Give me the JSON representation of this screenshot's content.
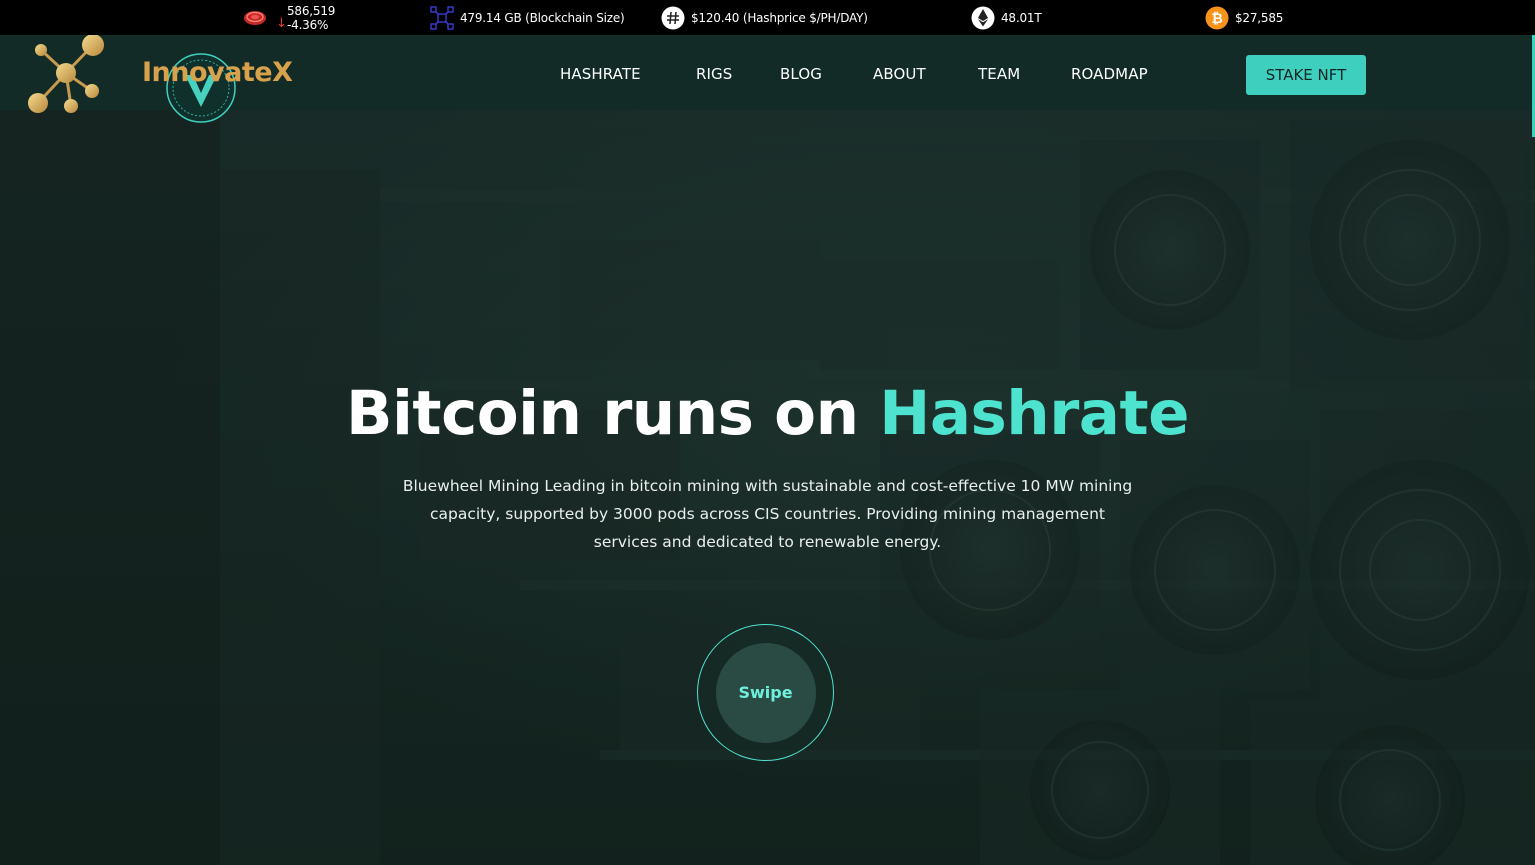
{
  "ticker": {
    "supply": {
      "value": "586,519",
      "change": "-4.36%",
      "icon": "red-coin-icon",
      "trend_icon": "arrow-down-icon"
    },
    "blockchain": {
      "text": "479.14 GB (Blockchain Size)",
      "icon": "blockchain-network-icon"
    },
    "hashprice": {
      "text": "$120.40 (Hashprice $/PH/DAY)",
      "icon": "hash-icon"
    },
    "ethereum": {
      "text": "48.01T",
      "icon": "ethereum-icon"
    },
    "bitcoin": {
      "text": "$27,585",
      "icon": "bitcoin-icon"
    }
  },
  "header": {
    "logo_text": "InnovateX",
    "nav": [
      "HASHRATE",
      "RIGS",
      "BLOG",
      "ABOUT",
      "TEAM",
      "ROADMAP"
    ],
    "cta": "STAKE NFT"
  },
  "hero": {
    "title_start": "Bitcoin runs on ",
    "title_accent": "Hashrate",
    "description": "Bluewheel Mining Leading in bitcoin mining with sustainable and cost-effective 10 MW mining capacity, supported by 3000 pods across CIS countries. Providing mining management services and dedicated to renewable energy.",
    "swipe_label": "Swipe"
  },
  "colors": {
    "accent": "#4ee3cf",
    "header_bg": "#122b27",
    "logo_gold": "#d8a24d",
    "button": "#3fcfbf"
  }
}
